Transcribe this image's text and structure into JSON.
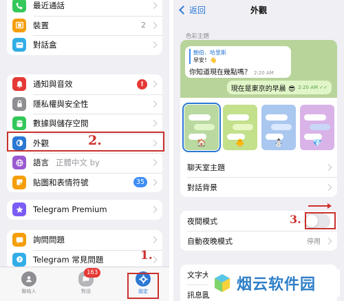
{
  "left": {
    "group1": [
      {
        "label": "最近通話",
        "icon": "phone-icon",
        "color": "#34c759"
      },
      {
        "label": "裝置",
        "icon": "tablet-icon",
        "color": "#f59e0b",
        "count": "2"
      },
      {
        "label": "對話盒",
        "icon": "chat-box-icon",
        "color": "#32ade6"
      }
    ],
    "group2": [
      {
        "label": "通知與音效",
        "icon": "bell-icon",
        "color": "#e53935",
        "badge": "!"
      },
      {
        "label": "隱私權與安全性",
        "icon": "lock-icon",
        "color": "#8e8e93"
      },
      {
        "label": "數據與儲存空間",
        "icon": "database-icon",
        "color": "#34c759"
      },
      {
        "label": "外觀",
        "icon": "appearance-icon",
        "color": "#2b78d4"
      },
      {
        "label": "語言",
        "icon": "globe-icon",
        "color": "#9b59d0",
        "sub": "正體中文 by"
      },
      {
        "label": "貼圖和表情符號",
        "icon": "sticker-icon",
        "color": "#f59e0b",
        "pill": "35"
      }
    ],
    "group3": [
      {
        "label": "Telegram Premium",
        "icon": "star-icon",
        "color": "#7b5cf5"
      }
    ],
    "group4": [
      {
        "label": "詢問問題",
        "icon": "question-chat-icon",
        "color": "#f59e0b"
      },
      {
        "label": "Telegram 常見問題",
        "icon": "help-icon",
        "color": "#32ade6"
      }
    ],
    "tabs": {
      "contacts": "聯絡人",
      "chats": "對話",
      "chats_badge": "163",
      "settings": "設定"
    },
    "annotations": {
      "step1": "1.",
      "step2": "2."
    }
  },
  "right": {
    "back": "返回",
    "title": "外觀",
    "section_color_theme": "色彩主題",
    "preview": {
      "reply_name": "鮑伯．哈里斯",
      "reply_text": "早安！👋",
      "incoming": "你知道現在幾點嗎？",
      "incoming_time": "2:20 AM",
      "outgoing": "現在是東京的早晨 😎",
      "outgoing_time": "2:20 AM ✓✓"
    },
    "themes": [
      {
        "name": "theme-day",
        "emoji": "🏠",
        "bg": "#b9d9a1",
        "accent": "#e1f6c8"
      },
      {
        "name": "theme-classic",
        "emoji": "🐥",
        "bg": "#c3e08b",
        "accent": "#e8f7c4"
      },
      {
        "name": "theme-snow",
        "emoji": "⛄",
        "bg": "#a9c7ef",
        "accent": "#dbe9ff"
      },
      {
        "name": "theme-diamond",
        "emoji": "💎",
        "bg": "#d9b3e8",
        "accent": "#c8d7f7"
      }
    ],
    "rows1": [
      {
        "label": "聊天室主題"
      },
      {
        "label": "對話背景"
      }
    ],
    "night_mode": "夜間模式",
    "auto_night": "自動夜晚模式",
    "auto_night_value": "停用",
    "night_mode_on": false,
    "rows3": [
      {
        "label": "文字大"
      },
      {
        "label": "訊息圓"
      }
    ],
    "annotation_step3": "3."
  },
  "watermark": "烟云软件园"
}
